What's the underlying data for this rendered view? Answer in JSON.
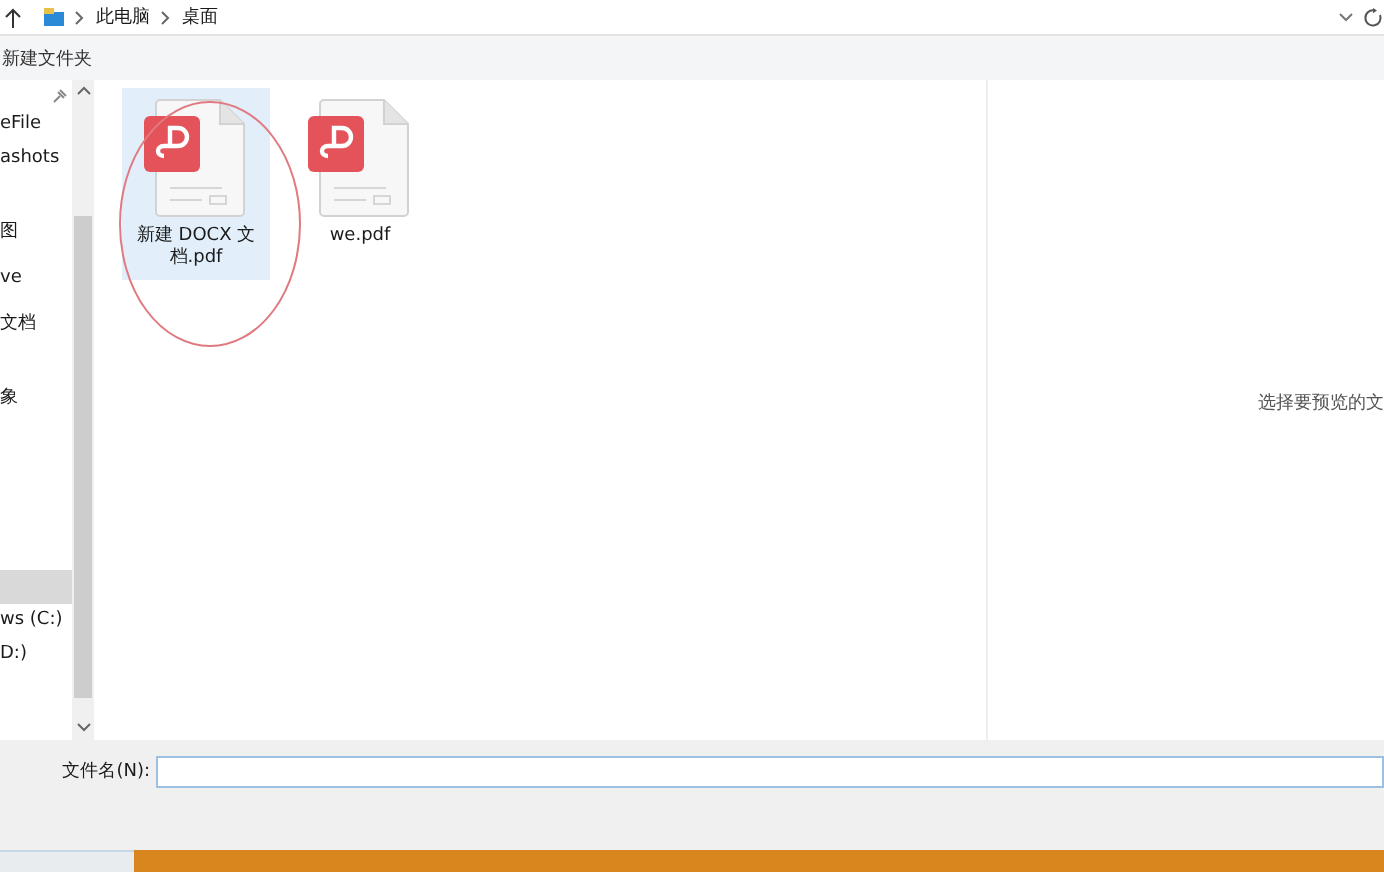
{
  "address_bar": {
    "path": [
      "此电脑",
      "桌面"
    ]
  },
  "toolbar": {
    "new_folder": "新建文件夹"
  },
  "sidebar": {
    "groups": [
      {
        "items": [
          {
            "label": "eFile",
            "selected": false
          },
          {
            "label": "ashots",
            "selected": false
          }
        ]
      },
      {
        "items": [
          {
            "label": "图",
            "selected": false
          },
          {
            "label": "ve",
            "selected": false
          },
          {
            "label": "文档",
            "selected": false
          }
        ]
      },
      {
        "items": [
          {
            "label": "象",
            "selected": false
          }
        ]
      },
      {
        "items": [
          {
            "selected": true
          },
          {
            "label": "ws (C:)",
            "selected": false
          },
          {
            "label": "D:)",
            "selected": false
          }
        ]
      }
    ]
  },
  "files": [
    {
      "name": "新建 DOCX 文档.pdf",
      "selected": true,
      "circled": true
    },
    {
      "name": "we.pdf",
      "selected": false,
      "circled": false
    }
  ],
  "preview": {
    "hint": "选择要预览的文"
  },
  "footer": {
    "filename_label": "文件名(N):"
  }
}
